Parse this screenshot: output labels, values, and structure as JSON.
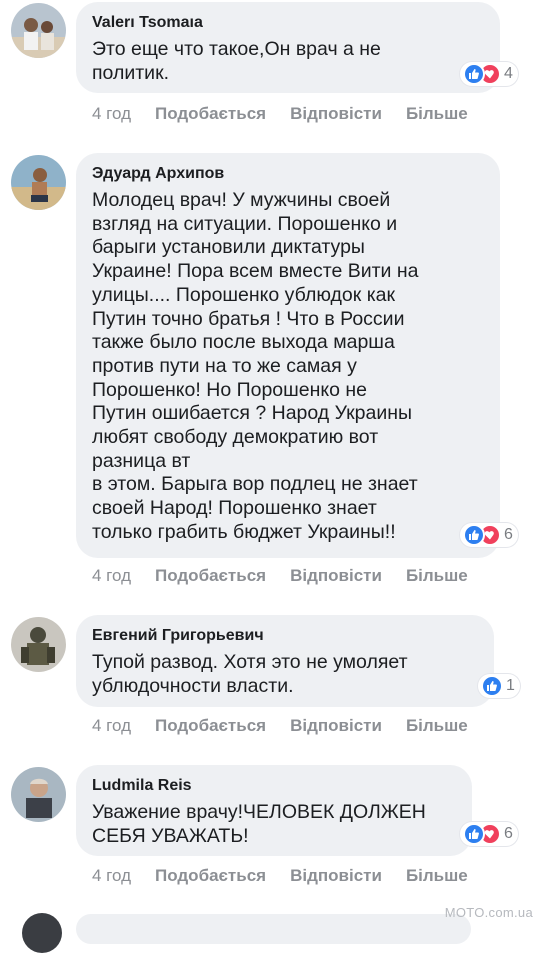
{
  "comments": [
    {
      "author": "Valerı Tsomaıa",
      "text": "Это еще что такое,Он врач а не\nполитик.",
      "reactions": {
        "types": [
          "like",
          "love"
        ],
        "count": "4"
      },
      "time": "4 год",
      "actions": {
        "like": "Подобається",
        "reply": "Відповісти",
        "more": "Більше"
      }
    },
    {
      "author": "Эдуард Архипов",
      "text": "Молодец врач! У мужчины своей\nвзгляд на ситуации. Порошенко и\nбарыги установили диктатуры\nУкраине! Пора всем вместе Вити на\nулицы.... Порошенко ублюдок как\nПутин точно братья ! Что в России\nтакже было после выхода марша\nпротив пути на то же самая у\nПорошенко! Но Порошенко не\nПутин ошибается ? Народ Украины\nлюбят свободу демократию вот\nразница вт\nв этом. Барыга вор подлец не знает\nсвоей Народ! Порошенко знает\nтолько грабить бюджет Украины!!",
      "reactions": {
        "types": [
          "like",
          "love"
        ],
        "count": "6"
      },
      "time": "4 год",
      "actions": {
        "like": "Подобається",
        "reply": "Відповісти",
        "more": "Більше"
      }
    },
    {
      "author": "Евгений Григорьевич",
      "text": "Тупой развод. Хотя это не умоляет\nублюдочности власти.",
      "reactions": {
        "types": [
          "like"
        ],
        "count": "1"
      },
      "time": "4 год",
      "actions": {
        "like": "Подобається",
        "reply": "Відповісти",
        "more": "Більше"
      }
    },
    {
      "author": "Ludmila Reis",
      "text": "Уважение врачу!ЧЕЛОВЕК ДОЛЖЕН\nСЕБЯ УВАЖАТЬ!",
      "reactions": {
        "types": [
          "like",
          "love"
        ],
        "count": "6"
      },
      "time": "4 год",
      "actions": {
        "like": "Подобається",
        "reply": "Відповісти",
        "more": "Більше"
      }
    }
  ],
  "watermark": "MOTO.com.ua",
  "colors": {
    "bubble": "#eef0f3",
    "like": "#2d7ff0",
    "love": "#f0405c",
    "meta": "#8c8f94"
  }
}
